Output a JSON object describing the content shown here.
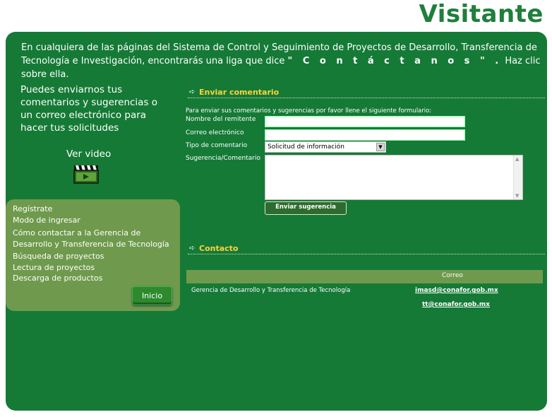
{
  "page": {
    "title": "Visitante"
  },
  "intro": {
    "before": "En cualquiera de las páginas del Sistema de Control y Seguimiento de Proyectos de Desarrollo, Transferencia de Tecnología e Investigación, encontrarás una liga que dice ",
    "keyword": "\" C o n t á c t a n o s \" .",
    "after": " Haz clic sobre ella."
  },
  "side": {
    "text": "Puedes enviarnos tus comentarios y sugerencias o un correo electrónico para hacer tus solicitudes",
    "video_label": "Ver video",
    "video_icon": "clapperboard-icon"
  },
  "menu": {
    "items": [
      "Regístrate",
      "Modo de ingresar",
      "Cómo contactar a la Gerencia de",
      "Desarrollo y Transferencia de Tecnología",
      "Búsqueda de proyectos",
      "Lectura de proyectos",
      "Descarga de productos"
    ],
    "inicio_label": "Inicio"
  },
  "form": {
    "heading": "Enviar comentario",
    "intro": "Para enviar sus comentarios y sugerencias por favor llene el siguiente formulario:",
    "name_label": "Nombre del remitente",
    "email_label": "Correo electrónico",
    "type_label": "Tipo de comentario",
    "type_selected": "Solicitud de información",
    "comment_label": "Sugerencia/Comentario",
    "submit_label": "Enviar sugerencia"
  },
  "contact": {
    "heading": "Contacto",
    "column_header": "Correo",
    "name": "Gerencia de Desarrollo y Transferencia de Tecnología",
    "emails": [
      "imasd@conafor.gob.mx",
      "tt@conafor.gob.mx"
    ]
  },
  "colors": {
    "panel": "#157a36",
    "menu_box": "#6f9a4d",
    "heading_accent": "#ffd23a",
    "title": "#1f7f3b"
  }
}
